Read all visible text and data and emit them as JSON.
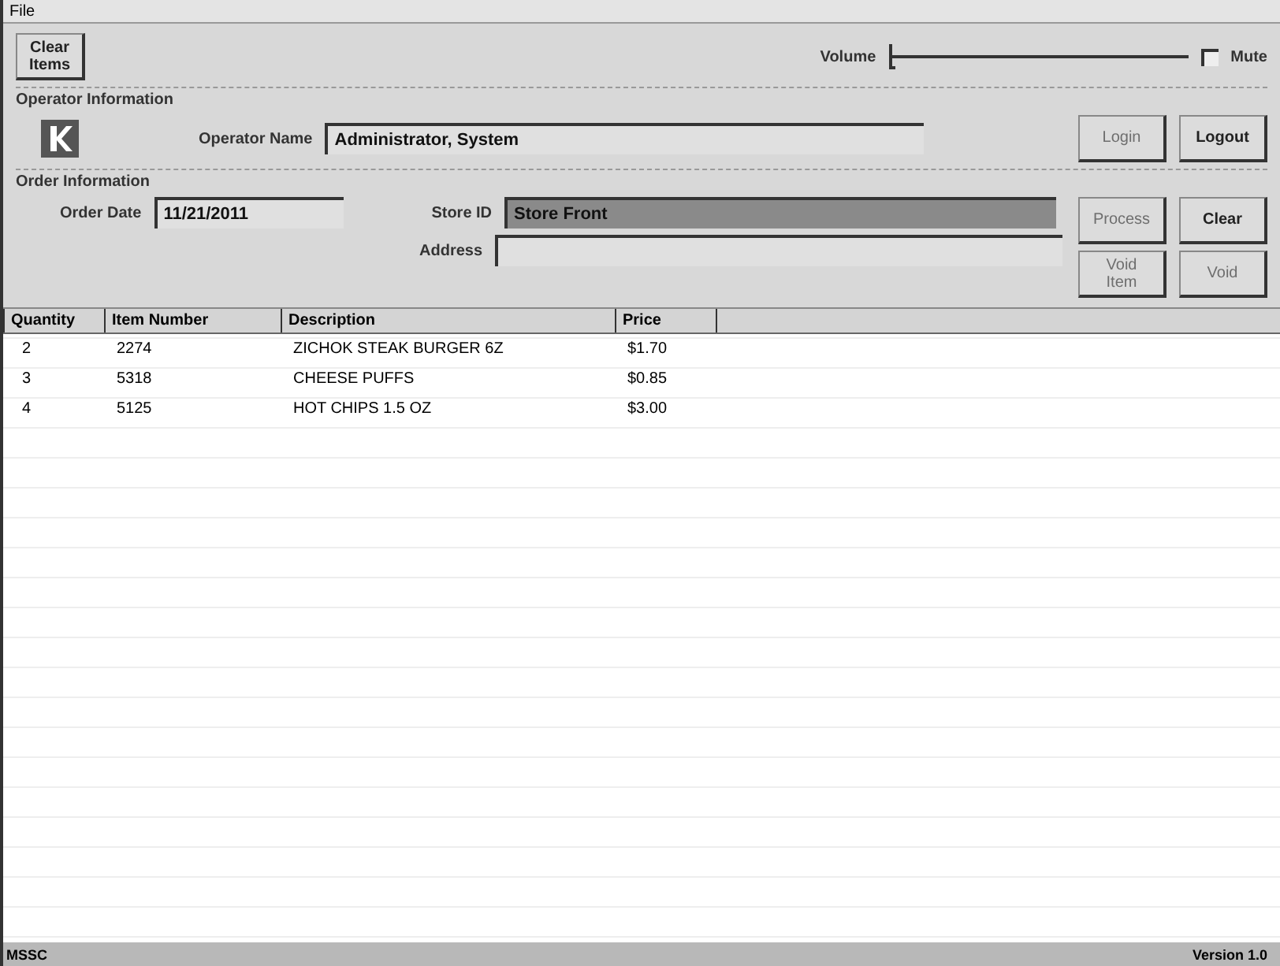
{
  "menu": [
    "File"
  ],
  "clear_items_button": {
    "label": "Clear Items"
  },
  "volume": {
    "label": "Volume",
    "level": 0.0
  },
  "mute": {
    "label": "Mute",
    "checked": false
  },
  "operator": {
    "title": "Operator Information",
    "name_label": "Operator Name",
    "name_value": "Administrator, System"
  },
  "operator_buttons": [
    {
      "label": "Login",
      "disabled": true
    },
    {
      "label": "Logout",
      "disabled": false
    }
  ],
  "order": {
    "title": "Order Information",
    "date_label": "Order Date",
    "date_value": "11/21/2011",
    "store_label": "Store ID",
    "store_value": "Store Front",
    "address_label": "Address"
  },
  "order_buttons": [
    {
      "label": "Process",
      "disabled": true
    },
    {
      "label": "Clear",
      "disabled": false
    },
    {
      "label": "Void Item",
      "disabled": true
    },
    {
      "label": "Void",
      "disabled": true
    }
  ],
  "table": {
    "columns": [
      "Quantity",
      "Item Number",
      "Description",
      "Price"
    ],
    "rows": [
      [
        "2",
        "2274",
        "ZICHOK STEAK BURGER 6Z",
        "$1.70"
      ],
      [
        "3",
        "5318",
        "CHEESE PUFFS",
        "$0.85"
      ],
      [
        "4",
        "5125",
        "HOT CHIPS 1.5 OZ",
        "$3.00"
      ]
    ]
  },
  "status_bar": {
    "left": "MSSC",
    "right": "Version 1.0"
  }
}
